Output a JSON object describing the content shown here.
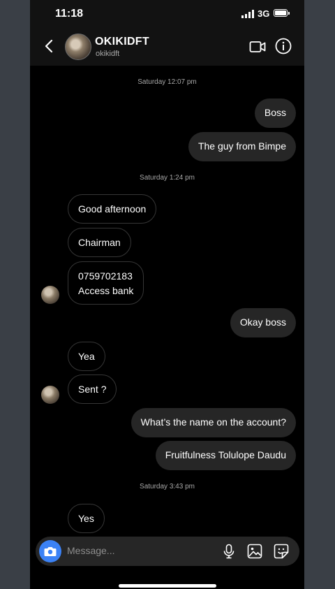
{
  "status_bar": {
    "time": "11:18",
    "network": "3G"
  },
  "header": {
    "name": "OKIKIDFT",
    "username": "okikidft"
  },
  "messages": [
    {
      "type": "timestamp",
      "text": "Saturday 12:07 pm"
    },
    {
      "type": "sent",
      "text": "Boss"
    },
    {
      "type": "sent",
      "text": "The guy from Bimpe"
    },
    {
      "type": "timestamp",
      "text": "Saturday 1:24 pm"
    },
    {
      "type": "received",
      "text": "Good afternoon"
    },
    {
      "type": "received",
      "text": "Chairman"
    },
    {
      "type": "received",
      "lines": [
        "0759702183",
        "Access bank"
      ]
    },
    {
      "type": "sent",
      "text": "Okay boss"
    },
    {
      "type": "received",
      "text": "Yea"
    },
    {
      "type": "received",
      "text": "Sent ?"
    },
    {
      "type": "sent",
      "text": "What’s the name on the account?"
    },
    {
      "type": "sent",
      "text": "Fruitfulness Tolulope Daudu"
    },
    {
      "type": "timestamp",
      "text": "Saturday 3:43 pm"
    },
    {
      "type": "received",
      "text": "Yes"
    }
  ],
  "composer": {
    "placeholder": "Message..."
  },
  "icons": {
    "back": "chevron-left-icon",
    "video": "video-camera-icon",
    "info": "info-icon",
    "camera": "camera-icon",
    "mic": "microphone-icon",
    "gallery": "gallery-icon",
    "sticker": "sticker-icon"
  },
  "colors": {
    "background": "#000000",
    "bubble_sent": "#262626",
    "bubble_received_border": "#363636",
    "camera_button": "#3b82f6"
  }
}
